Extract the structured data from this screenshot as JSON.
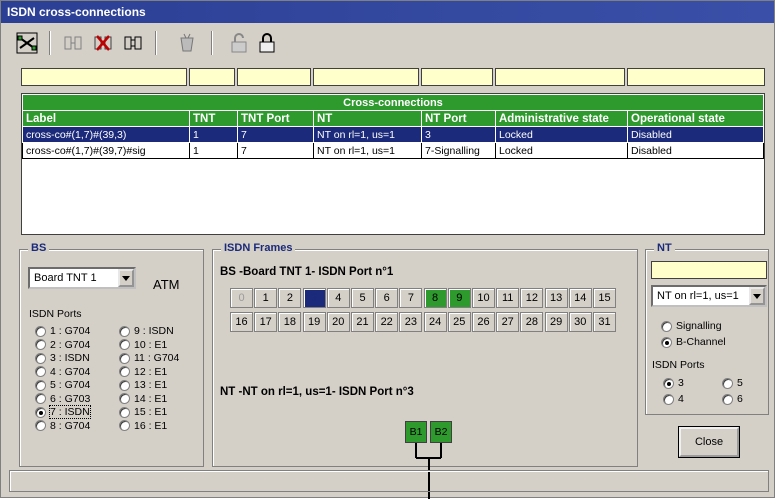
{
  "window": {
    "title": "ISDN cross-connections"
  },
  "toolbar": {
    "buttons": [
      {
        "icon": "cross-connect-icon"
      },
      {
        "icon": "add-connection-icon"
      },
      {
        "icon": "delete-connection-icon"
      },
      {
        "icon": "modify-connection-icon"
      },
      {
        "icon": "clear-icon"
      },
      {
        "icon": "lock-open-icon"
      },
      {
        "icon": "lock-closed-icon"
      }
    ]
  },
  "table": {
    "caption": "Cross-connections",
    "columns": [
      "Label",
      "TNT",
      "TNT Port",
      "NT",
      "NT Port",
      "Administrative state",
      "Operational state"
    ],
    "rows": [
      [
        "cross-co#(1,7)#(39,3)",
        "1",
        "7",
        "NT on rl=1, us=1",
        "3",
        "Locked",
        "Disabled"
      ],
      [
        "cross-co#(1,7)#(39,7)#sig",
        "1",
        "7",
        "NT on rl=1, us=1",
        "7-Signalling",
        "Locked",
        "Disabled"
      ]
    ],
    "selected_row": 0
  },
  "bs": {
    "title": "BS",
    "board_select": "Board TNT 1",
    "atm_label": "ATM",
    "ports_label": "ISDN Ports",
    "ports_left": [
      "1 : G704",
      "2 : G704",
      "3 : ISDN",
      "4 : G704",
      "5 : G704",
      "6 : G703",
      "7 : ISDN",
      "8 : G704"
    ],
    "ports_right": [
      "9 : ISDN",
      "10 : E1",
      "11 : G704",
      "12 : E1",
      "13 : E1",
      "14 : E1",
      "15 : E1",
      "16 : E1"
    ],
    "selected_port": "7 : ISDN"
  },
  "frames": {
    "title": "ISDN Frames",
    "bs_caption": "BS -Board TNT 1- ISDN Port n°1",
    "nt_caption": "NT -NT on rl=1, us=1- ISDN Port n°3",
    "row1": [
      "0",
      "1",
      "2",
      "3",
      "4",
      "5",
      "6",
      "7",
      "8",
      "9",
      "10",
      "11",
      "12",
      "13",
      "14",
      "15"
    ],
    "row2": [
      "16",
      "17",
      "18",
      "19",
      "20",
      "21",
      "22",
      "23",
      "24",
      "25",
      "26",
      "27",
      "28",
      "29",
      "30",
      "31"
    ],
    "b_channels": [
      "B1",
      "B2"
    ]
  },
  "nt": {
    "title": "NT",
    "field_value": "",
    "select": "NT on rl=1, us=1",
    "signalling_label": "Signalling",
    "bchannel_label": "B-Channel",
    "ports_label": "ISDN Ports",
    "ports": [
      "3",
      "5",
      "4",
      "6"
    ]
  },
  "close_label": "Close",
  "colors": {
    "accent_green": "#2e9a2e",
    "selection_blue": "#1b2a7a",
    "field_yellow": "#ffffcc"
  }
}
